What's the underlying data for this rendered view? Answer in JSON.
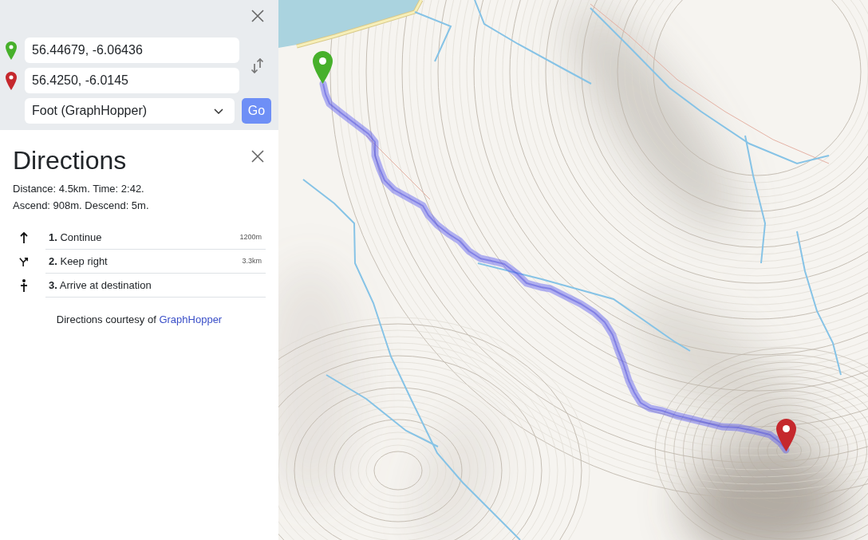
{
  "routing_form": {
    "waypoints": [
      {
        "value": "56.44679, -6.06436",
        "color": "#47b02b"
      },
      {
        "value": "56.4250, -6.0145",
        "color": "#c5282d"
      }
    ],
    "profile": {
      "value": "Foot (GraphHopper)"
    },
    "go_button": "Go"
  },
  "directions": {
    "title": "Directions",
    "summary": [
      "Distance: 4.5km. Time: 2:42.",
      "Ascend: 908m. Descend: 5m."
    ],
    "steps": [
      {
        "kind": "straight",
        "text": "**1.** Continue",
        "distance": "1200m"
      },
      {
        "kind": "keep_right",
        "text": "**2.** Keep right",
        "distance": "3.3km"
      },
      {
        "kind": "arrive",
        "text": "**3.** Arrive at destination"
      }
    ],
    "attribution": {
      "text": "Directions courtesy of",
      "link": "GraphHopper"
    }
  },
  "map": {
    "markers": [
      {
        "kind": "start",
        "color": "#47b02b"
      },
      {
        "kind": "end",
        "color": "#c5282d"
      }
    ]
  }
}
